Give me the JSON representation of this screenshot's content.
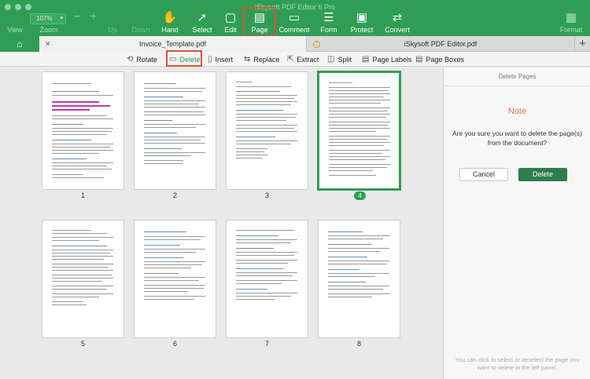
{
  "app": {
    "title": "iSkysoft PDF Editor 6 Pro"
  },
  "colors": {
    "accent": "#2f9e54",
    "highlight": "#e0513a",
    "note": "#e07a43"
  },
  "toolbar": {
    "zoom_value": "107%",
    "zoom_minus": "−",
    "zoom_plus": "+",
    "items": [
      {
        "label": "View",
        "icon": "view-icon"
      },
      {
        "label": "Zoom",
        "icon": "zoom-icon"
      },
      {
        "label": "Up",
        "icon": "arrow-up-icon"
      },
      {
        "label": "Down",
        "icon": "arrow-down-icon"
      },
      {
        "label": "Hand",
        "icon": "hand-icon"
      },
      {
        "label": "Select",
        "icon": "cursor-icon"
      },
      {
        "label": "Edit",
        "icon": "edit-icon"
      },
      {
        "label": "Page",
        "icon": "page-icon"
      },
      {
        "label": "Comment",
        "icon": "comment-icon"
      },
      {
        "label": "Form",
        "icon": "form-icon"
      },
      {
        "label": "Protect",
        "icon": "lock-icon"
      },
      {
        "label": "Convert",
        "icon": "convert-icon"
      },
      {
        "label": "Format",
        "icon": "format-icon"
      }
    ]
  },
  "tabs": [
    {
      "label": "Invoice_Template.pdf"
    },
    {
      "label": "iSkysoft PDF Editor.pdf"
    }
  ],
  "page_tools": [
    {
      "label": "Rotate",
      "icon": "rotate-icon"
    },
    {
      "label": "Delete",
      "icon": "delete-icon"
    },
    {
      "label": "Insert",
      "icon": "insert-icon"
    },
    {
      "label": "Replace",
      "icon": "replace-icon"
    },
    {
      "label": "Extract",
      "icon": "extract-icon"
    },
    {
      "label": "Split",
      "icon": "split-icon"
    },
    {
      "label": "Page Labels",
      "icon": "page-labels-icon"
    },
    {
      "label": "Page Boxes",
      "icon": "page-boxes-icon"
    }
  ],
  "pages": [
    {
      "number": "1",
      "selected": false
    },
    {
      "number": "2",
      "selected": false
    },
    {
      "number": "3",
      "selected": false
    },
    {
      "number": "4",
      "selected": true
    },
    {
      "number": "5",
      "selected": false
    },
    {
      "number": "6",
      "selected": false
    },
    {
      "number": "7",
      "selected": false
    },
    {
      "number": "8",
      "selected": false
    }
  ],
  "panel": {
    "header": "Delete Pages",
    "note_title": "Note",
    "message": "Are you sure you want to delete the page(s) from the document?",
    "cancel_label": "Cancel",
    "delete_label": "Delete",
    "help_text": "You can click to select or deselect the page you want to delete in the left panel."
  }
}
